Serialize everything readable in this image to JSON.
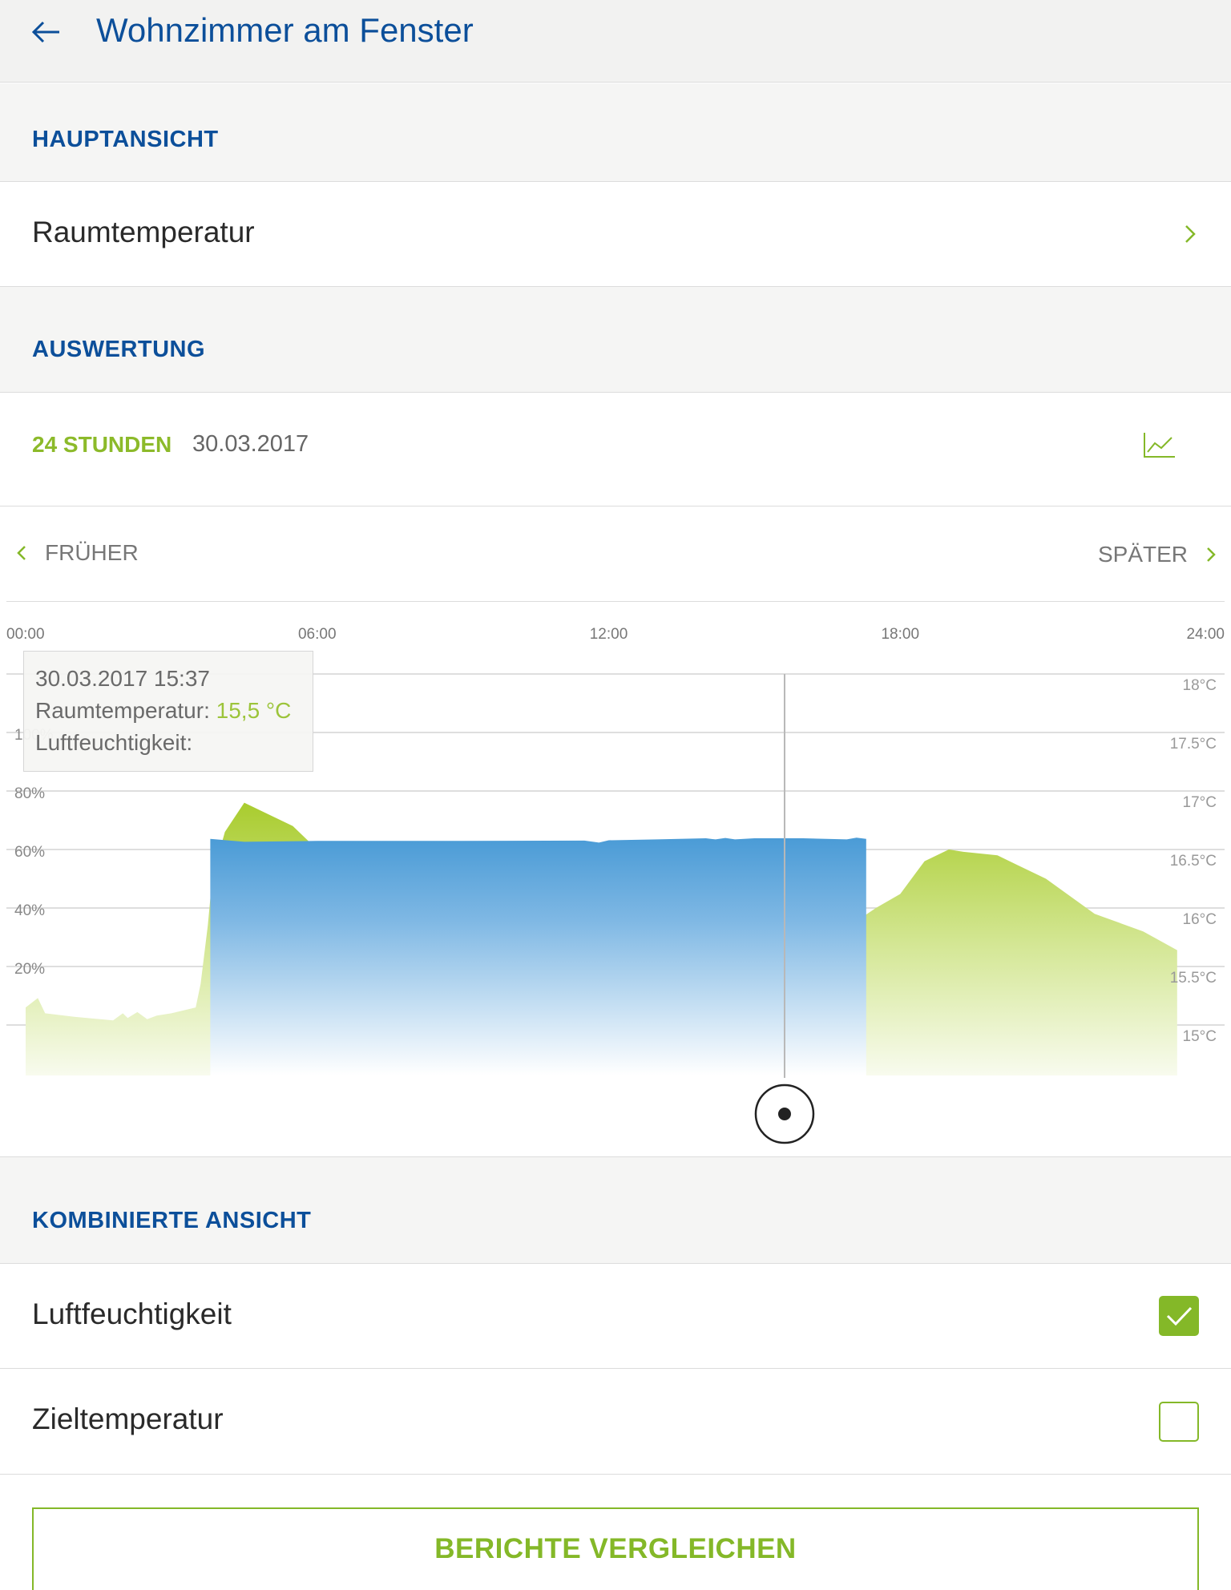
{
  "header": {
    "title": "Wohnzimmer am Fenster",
    "back_icon": "arrow-left-icon"
  },
  "main_view": {
    "section_label": "HAUPTANSICHT",
    "selected_metric": "Raumtemperatur"
  },
  "evaluation": {
    "section_label": "AUSWERTUNG",
    "range_label": "24 STUNDEN",
    "date": "30.03.2017",
    "chart_toggle_icon": "line-chart-icon",
    "prev_label": "FRÜHER",
    "next_label": "SPÄTER"
  },
  "tooltip": {
    "timestamp": "30.03.2017 15:37",
    "temp_label": "Raumtemperatur:",
    "temp_value": "15,5 °C",
    "humidity_label": "Luftfeuchtigkeit:"
  },
  "combined_view": {
    "section_label": "KOMBINIERTE ANSICHT",
    "options": [
      {
        "label": "Luftfeuchtigkeit",
        "checked": true
      },
      {
        "label": "Zieltemperatur",
        "checked": false
      }
    ]
  },
  "compare_button": "BERICHTE VERGLEICHEN",
  "colors": {
    "brand_blue": "#0c4f9a",
    "accent_green": "#84b828",
    "humidity_blue": "#4a9bd6"
  },
  "chart_data": {
    "type": "area",
    "x_ticks": [
      "00:00",
      "06:00",
      "12:00",
      "18:00",
      "24:00"
    ],
    "xlim": [
      0,
      24
    ],
    "y_left_ticks": [
      "20%",
      "40%",
      "60%",
      "80%",
      "100%"
    ],
    "ylim_left": [
      20,
      100
    ],
    "y_right_ticks": [
      "15°C",
      "15.5°C",
      "16°C",
      "16.5°C",
      "17°C",
      "17.5°C",
      "18°C"
    ],
    "ylim_right": [
      15,
      18
    ],
    "cursor_time": 15.62,
    "series": [
      {
        "axis": "right",
        "x": [
          0,
          0.25,
          0.4,
          1.0,
          1.8,
          2.0,
          2.1,
          2.3,
          2.5,
          2.7,
          3.0,
          3.5,
          3.6,
          3.75,
          3.85,
          4.0,
          4.1,
          4.5,
          5.5,
          6.0,
          6.5,
          7.0,
          9.0,
          12.0,
          13.0,
          15.0,
          16.5,
          17.0,
          17.5,
          18.0,
          18.5,
          19.0,
          19.3,
          20.0,
          21.0,
          22.0,
          23.0,
          23.7
        ],
        "values": [
          15.15,
          15.23,
          15.1,
          15.07,
          15.04,
          15.1,
          15.06,
          15.11,
          15.05,
          15.08,
          15.1,
          15.15,
          15.35,
          15.85,
          16.3,
          16.5,
          16.65,
          16.9,
          16.7,
          16.5,
          16.25,
          16.05,
          15.62,
          15.44,
          15.47,
          15.5,
          15.75,
          15.86,
          16.0,
          16.12,
          16.4,
          16.5,
          16.48,
          16.45,
          16.25,
          15.95,
          15.8,
          15.64
        ]
      },
      {
        "axis": "left",
        "x": [
          3.8,
          4.5,
          6.0,
          9.0,
          11.5,
          11.8,
          12.0,
          13.0,
          14.0,
          14.2,
          14.4,
          14.6,
          15.0,
          16.0,
          16.9,
          17.1,
          17.3
        ],
        "values": [
          62.0,
          61.0,
          61.3,
          61.3,
          61.4,
          60.7,
          61.5,
          61.8,
          62.2,
          61.8,
          62.3,
          61.8,
          62.2,
          62.2,
          61.8,
          62.4,
          62.0
        ]
      }
    ]
  }
}
